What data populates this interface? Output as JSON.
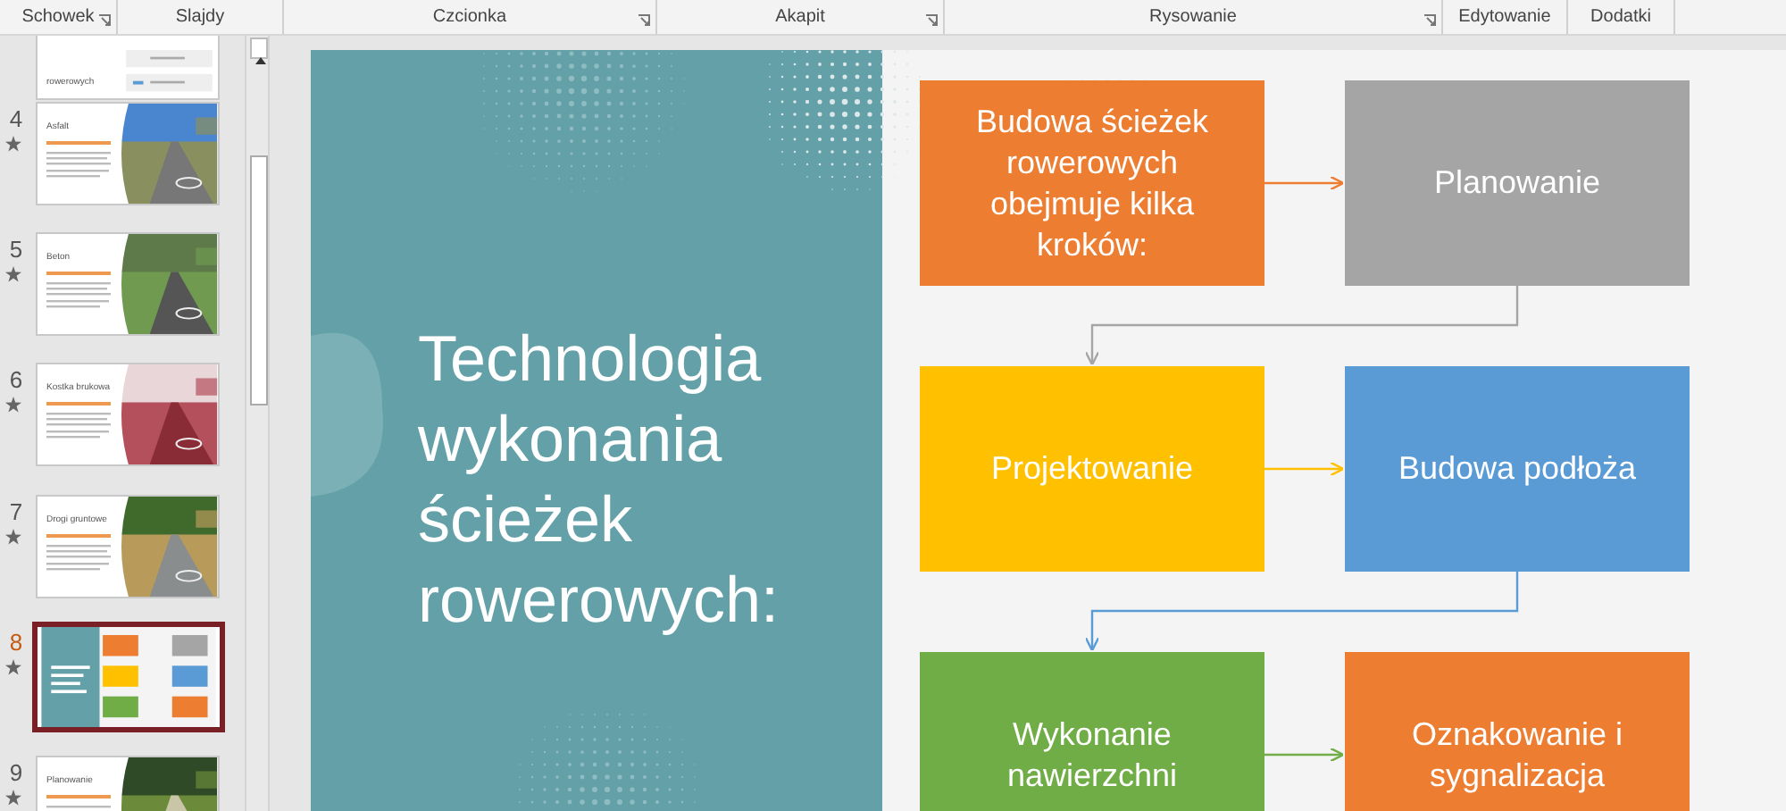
{
  "ribbon": {
    "groups": [
      {
        "label": "Schowek",
        "launcher": true
      },
      {
        "label": "Slajdy",
        "launcher": false
      },
      {
        "label": "Czcionka",
        "launcher": true
      },
      {
        "label": "Akapit",
        "launcher": true
      },
      {
        "label": "Rysowanie",
        "launcher": true
      },
      {
        "label": "Edytowanie",
        "launcher": false
      },
      {
        "label": "Dodatki",
        "launcher": false
      }
    ]
  },
  "thumbnails": [
    {
      "title": "rowerowych",
      "selected": false,
      "kind": "list"
    },
    {
      "number": "4",
      "title": "Asfalt",
      "animated": true,
      "selected": false,
      "kind": "picture"
    },
    {
      "number": "5",
      "title": "Beton",
      "animated": true,
      "selected": false,
      "kind": "picture"
    },
    {
      "number": "6",
      "title": "Kostka brukowa",
      "animated": true,
      "selected": false,
      "kind": "picture"
    },
    {
      "number": "7",
      "title": "Drogi gruntowe",
      "animated": true,
      "selected": false,
      "kind": "picture"
    },
    {
      "number": "8",
      "animated": true,
      "selected": true,
      "kind": "diagram"
    },
    {
      "number": "9",
      "title": "Planowanie",
      "animated": true,
      "selected": false,
      "kind": "picture"
    }
  ],
  "slide": {
    "title": "Technologia wykonania ścieżek rowerowych:",
    "steps": [
      {
        "text": "Budowa ścieżek rowerowych obejmuje kilka kroków:",
        "color": "#ed7d31"
      },
      {
        "text": "Planowanie",
        "color": "#a5a5a5"
      },
      {
        "text": "Projektowanie",
        "color": "#ffc000"
      },
      {
        "text": "Budowa podłoża",
        "color": "#5b9bd5"
      },
      {
        "text": "Wykonanie nawierzchni",
        "color": "#70ad47"
      },
      {
        "text": "Oznakowanie i sygnalizacja",
        "color": "#ed7d31"
      }
    ]
  }
}
